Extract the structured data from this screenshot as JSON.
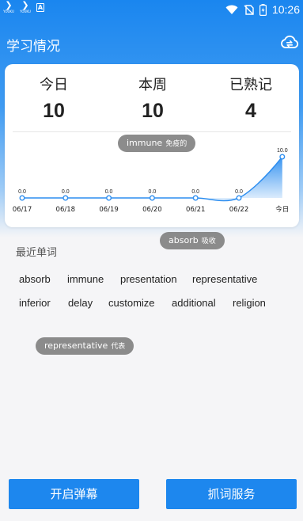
{
  "status_bar": {
    "app_label_small": "YOUKU",
    "time": "10:26"
  },
  "header": {
    "title": "学习情况"
  },
  "stats": [
    {
      "label": "今日",
      "value": "10"
    },
    {
      "label": "本周",
      "value": "10"
    },
    {
      "label": "已熟记",
      "value": "4"
    }
  ],
  "chart_data": {
    "type": "area",
    "categories": [
      "06/17",
      "06/18",
      "06/19",
      "06/20",
      "06/21",
      "06/22",
      "今日"
    ],
    "values": [
      0.0,
      0.0,
      0.0,
      0.0,
      0.0,
      0.0,
      10.0
    ],
    "value_labels": [
      "0.0",
      "0.0",
      "0.0",
      "0.0",
      "0.0",
      "0.0",
      "10.0"
    ],
    "title": "",
    "xlabel": "",
    "ylabel": "",
    "ylim": [
      0,
      10
    ],
    "grid": false,
    "colors": {
      "line": "#2d8ef0",
      "fill": "#2d8ef0"
    }
  },
  "danmaku": [
    {
      "word": "immune",
      "meaning": "免疫的"
    },
    {
      "word": "absorb",
      "meaning": "吸收"
    },
    {
      "word": "representative",
      "meaning": "代表"
    }
  ],
  "recent": {
    "title": "最近单词",
    "words": [
      "absorb",
      "immune",
      "presentation",
      "representative",
      "inferior",
      "delay",
      "customize",
      "additional",
      "religion"
    ]
  },
  "buttons": {
    "danmaku": "开启弹幕",
    "capture": "抓词服务"
  },
  "colors": {
    "accent": "#1d87ee",
    "bubble": "#7a7a7a"
  }
}
